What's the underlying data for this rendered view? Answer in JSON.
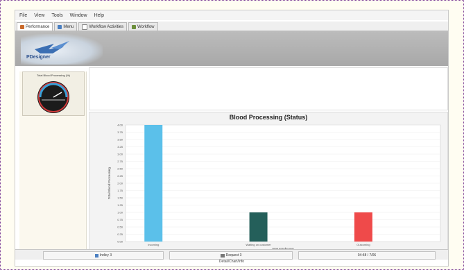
{
  "menu": [
    "File",
    "View",
    "Tools",
    "Window",
    "Help"
  ],
  "tabs": [
    {
      "label": "Performance",
      "icon": "performance-icon",
      "active": true
    },
    {
      "label": "Menu",
      "icon": "menu-icon",
      "active": false
    },
    {
      "label": "Workflow Activities",
      "icon": "workflow-activities-icon",
      "active": false
    },
    {
      "label": "Workflow",
      "icon": "workflow-icon",
      "active": false
    }
  ],
  "logo_text": "PDesigner",
  "gauge": {
    "title": "Total Blood Processing (%)"
  },
  "chart_data": {
    "type": "bar",
    "title": "Blood Processing (Status)",
    "xlabel": "StatusUnknown",
    "ylabel": "Total Blood Processing",
    "categories": [
      "Incoming",
      "Waiting on customer",
      "Outcoming"
    ],
    "values": [
      4.0,
      1.0,
      1.0
    ],
    "colors": [
      "#5bc0ea",
      "#245f5a",
      "#ef4a4a"
    ],
    "ylim": [
      0,
      4.0
    ],
    "yticks": [
      "4.00",
      "3.75",
      "3.50",
      "3.25",
      "3.00",
      "2.75",
      "2.50",
      "2.25",
      "2.00",
      "1.75",
      "1.50",
      "1.25",
      "1.00",
      "0.75",
      "0.50",
      "0.25",
      "0.00"
    ],
    "grid": true,
    "legend": "none"
  },
  "status": {
    "left": "Indicy 3",
    "middle": "Request 3",
    "right": "04:48 / 7/06"
  },
  "bottom_label": "Detail/Chart/Info"
}
